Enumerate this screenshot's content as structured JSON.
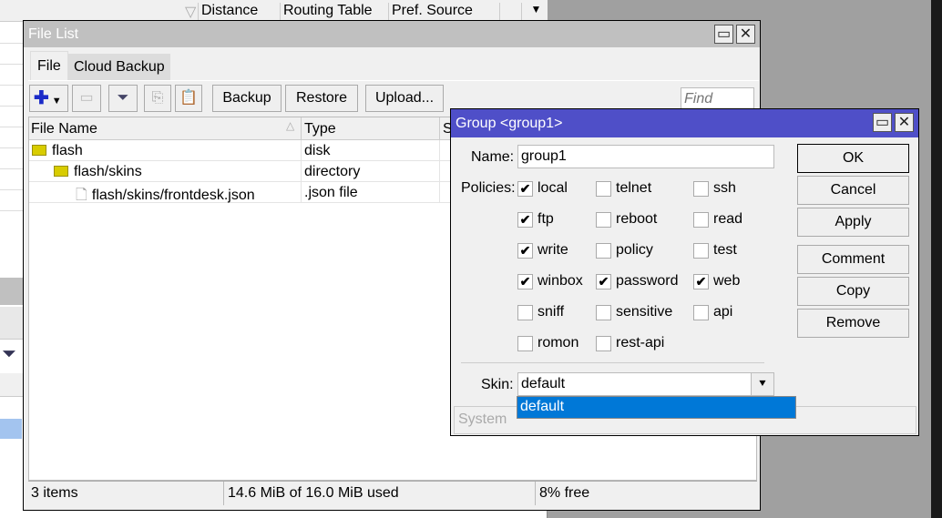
{
  "background": {
    "columns": [
      "Distance",
      "Routing Table",
      "Pref. Source"
    ]
  },
  "file_list": {
    "title": "File List",
    "tabs": [
      "File",
      "Cloud Backup"
    ],
    "toolbar": {
      "backup": "Backup",
      "restore": "Restore",
      "upload": "Upload...",
      "find_placeholder": "Find"
    },
    "columns": [
      "File Name",
      "Type",
      "S"
    ],
    "rows": [
      {
        "name": "flash",
        "type": "disk",
        "icon": "folder-icon"
      },
      {
        "name": "flash/skins",
        "type": "directory",
        "icon": "folder-icon"
      },
      {
        "name": "flash/skins/frontdesk.json",
        "type": ".json file",
        "icon": "file-icon"
      }
    ],
    "status": {
      "items": "3 items",
      "used": "14.6 MiB of 16.0 MiB used",
      "free": "8% free"
    }
  },
  "group_dialog": {
    "title": "Group <group1>",
    "name_label": "Name:",
    "name_value": "group1",
    "policies_label": "Policies:",
    "policies": [
      {
        "label": "local",
        "checked": true
      },
      {
        "label": "telnet",
        "checked": false
      },
      {
        "label": "ssh",
        "checked": false
      },
      {
        "label": "ftp",
        "checked": true
      },
      {
        "label": "reboot",
        "checked": false
      },
      {
        "label": "read",
        "checked": false
      },
      {
        "label": "write",
        "checked": true
      },
      {
        "label": "policy",
        "checked": false
      },
      {
        "label": "test",
        "checked": false
      },
      {
        "label": "winbox",
        "checked": true
      },
      {
        "label": "password",
        "checked": true
      },
      {
        "label": "web",
        "checked": true
      },
      {
        "label": "sniff",
        "checked": false
      },
      {
        "label": "sensitive",
        "checked": false
      },
      {
        "label": "api",
        "checked": false
      },
      {
        "label": "romon",
        "checked": false
      },
      {
        "label": "rest-api",
        "checked": false
      }
    ],
    "skin_label": "Skin:",
    "skin_value": "default",
    "skin_options": [
      "default"
    ],
    "buttons": {
      "ok": "OK",
      "cancel": "Cancel",
      "apply": "Apply",
      "comment": "Comment",
      "copy": "Copy",
      "remove": "Remove"
    },
    "status": "System",
    "check_mark": "✔",
    "title_color": "#4f4fc8",
    "selection_color": "#0078d7"
  }
}
